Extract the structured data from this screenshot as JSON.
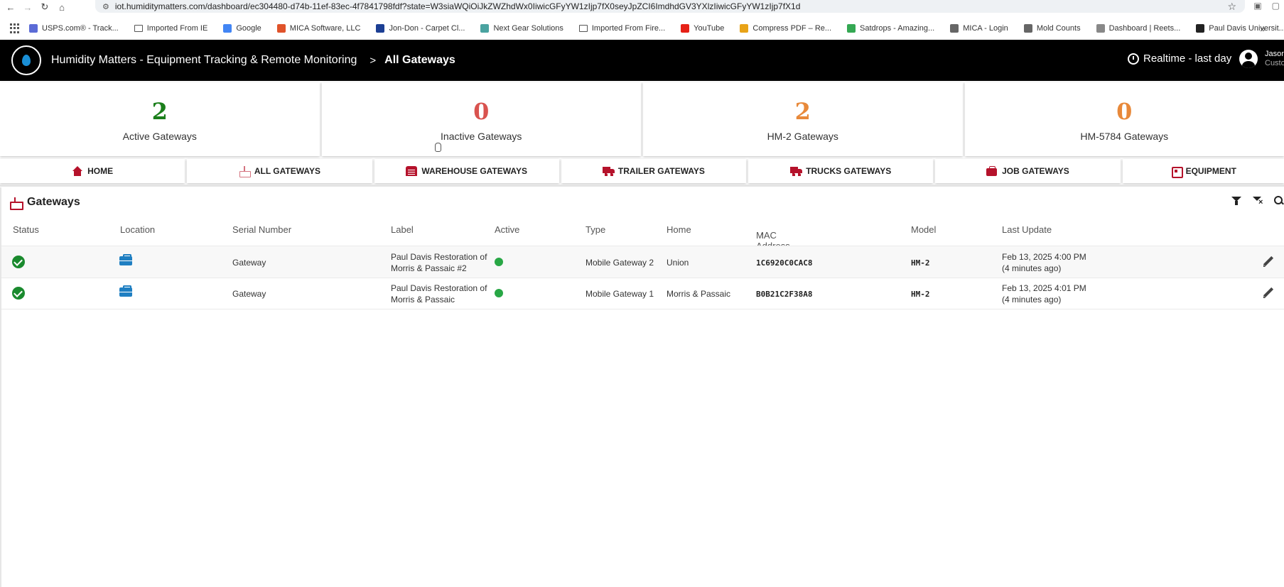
{
  "browser": {
    "url": "iot.humiditymatters.com/dashboard/ec304480-d74b-11ef-83ec-4f7841798fdf?state=W3siaWQiOiJkZWZhdWx0IiwicGFyYW1zIjp7fX0seyJpZCI6ImdhdGV3YXlzIiwicGFyYW1zIjp7fX1d",
    "bookmarks": [
      {
        "label": "USPS.com® - Track...",
        "color": "#5b6bd6"
      },
      {
        "label": "Imported From IE",
        "color": "folder"
      },
      {
        "label": "Google",
        "color": "#4285f4"
      },
      {
        "label": "MICA Software, LLC",
        "color": "#e0532a"
      },
      {
        "label": "Jon-Don - Carpet Cl...",
        "color": "#1c3f94"
      },
      {
        "label": "Next Gear Solutions",
        "color": "#4aa3a0"
      },
      {
        "label": "Imported From Fire...",
        "color": "folder"
      },
      {
        "label": "YouTube",
        "color": "#e62117"
      },
      {
        "label": "Compress PDF – Re...",
        "color": "#e8a318"
      },
      {
        "label": "Satdrops - Amazing...",
        "color": "#34a853"
      },
      {
        "label": "MICA - Login",
        "color": "#666666"
      },
      {
        "label": "Mold Counts",
        "color": "#666666"
      },
      {
        "label": "Dashboard | Reets...",
        "color": "#888888"
      },
      {
        "label": "Paul Davis Universit...",
        "color": "#222222"
      }
    ]
  },
  "header": {
    "app_title": "Humidity Matters - Equipment Tracking & Remote Monitoring",
    "separator": ">",
    "breadcrumb_current": "All Gateways",
    "timewindow": "Realtime - last day",
    "user_name": "Jason",
    "user_role": "Custo"
  },
  "stats": [
    {
      "value": "2",
      "label": "Active Gateways",
      "color": "#1b7f1b"
    },
    {
      "value": "0",
      "label": "Inactive Gateways",
      "color": "#d9534f"
    },
    {
      "value": "2",
      "label": "HM-2 Gateways",
      "color": "#e8893a"
    },
    {
      "value": "0",
      "label": "HM-5784 Gateways",
      "color": "#e8893a"
    }
  ],
  "tabs": [
    {
      "label": "HOME",
      "icon": "home-icon"
    },
    {
      "label": "ALL GATEWAYS",
      "icon": "router-icon"
    },
    {
      "label": "WAREHOUSE GATEWAYS",
      "icon": "warehouse-icon"
    },
    {
      "label": "TRAILER GATEWAYS",
      "icon": "truck-icon"
    },
    {
      "label": "TRUCKS GATEWAYS",
      "icon": "truck-icon"
    },
    {
      "label": "JOB GATEWAYS",
      "icon": "briefcase-icon"
    },
    {
      "label": "EQUIPMENT",
      "icon": "chip-icon"
    }
  ],
  "gateways": {
    "title": "Gateways",
    "columns": {
      "status": "Status",
      "location": "Location",
      "serial": "Serial Number",
      "label": "Label",
      "active": "Active",
      "type": "Type",
      "home": "Home",
      "mac": "MAC Address",
      "model": "Model",
      "last_update": "Last Update"
    },
    "sort_indicator": "↑",
    "rows": [
      {
        "serial": "Gateway",
        "label_line1": "Paul Davis Restoration of",
        "label_line2": "Morris & Passaic #2",
        "type": "Mobile Gateway 2",
        "home": "Union",
        "mac": "1C6920C0CAC8",
        "model": "HM-2",
        "last_update": "Feb 13, 2025 4:00 PM",
        "last_update_rel": "(4 minutes ago)"
      },
      {
        "serial": "Gateway",
        "label_line1": "Paul Davis Restoration of",
        "label_line2": "Morris & Passaic",
        "type": "Mobile Gateway 1",
        "home": "Morris & Passaic",
        "mac": "B0B21C2F38A8",
        "model": "HM-2",
        "last_update": "Feb 13, 2025 4:01 PM",
        "last_update_rel": "(4 minutes ago)"
      }
    ]
  }
}
